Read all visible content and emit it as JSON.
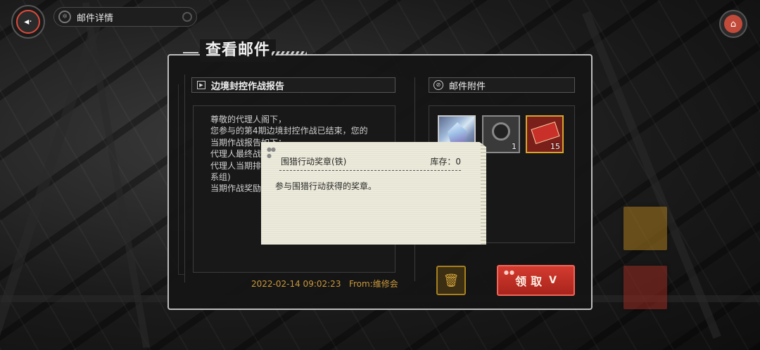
{
  "header": {
    "back_icon": "back-arrow-icon",
    "title": "邮件详情",
    "home_icon": "home-icon"
  },
  "panel": {
    "title": "查看邮件"
  },
  "mail": {
    "subject": "边境封控作战报告",
    "body_lines": [
      "尊敬的代理人阁下，",
      "您参与的第4期边境封控作战已结束，您的",
      "当期作战报告如下：",
      "代理人最终战",
      "代理人当期排",
      "系组)",
      "当期作战奖励已"
    ],
    "datetime": "2022-02-14 09:02:23",
    "from": "From:维修会"
  },
  "attachments": {
    "header": "邮件附件",
    "items": [
      {
        "name": "crystal-item",
        "count": ""
      },
      {
        "name": "medal-item",
        "count": "1"
      },
      {
        "name": "ticket-item",
        "count": "15"
      }
    ]
  },
  "actions": {
    "delete_icon": "trash-icon",
    "claim_label": "领取",
    "claim_chevron": "»"
  },
  "tooltip": {
    "item_name": "围猎行动奖章(铁)",
    "stock": "库存：0",
    "description": "参与围猎行动获得的奖章。"
  },
  "colors": {
    "accent_red": "#d43b2f",
    "gold": "#c9983b",
    "tooltip_bg": "#eceada"
  }
}
